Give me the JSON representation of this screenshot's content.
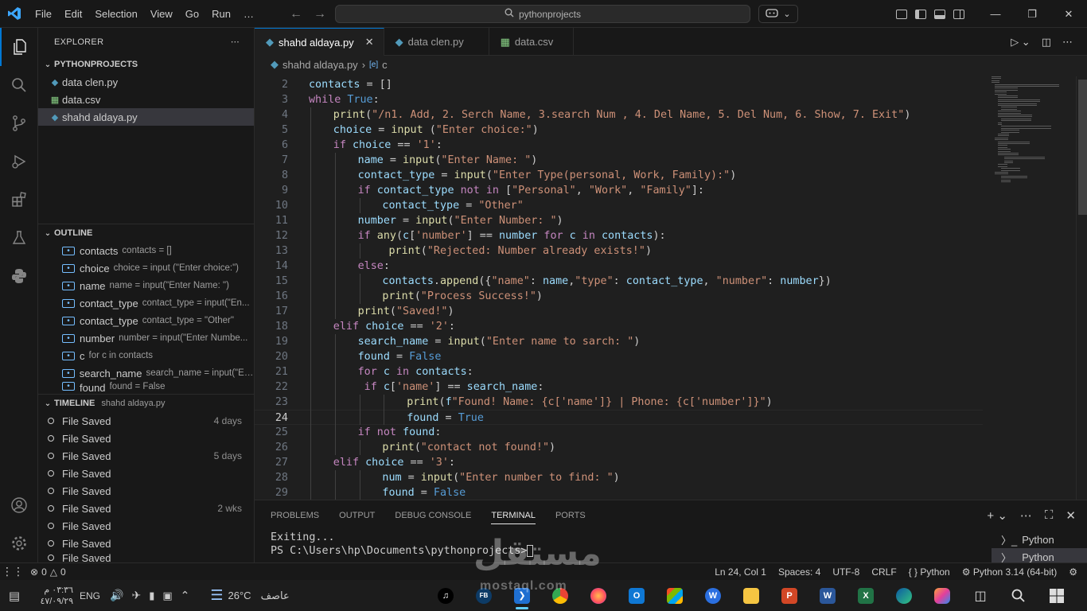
{
  "titlebar": {
    "menu": [
      "File",
      "Edit",
      "Selection",
      "View",
      "Go",
      "Run",
      "…"
    ],
    "search_text": "pythonprojects"
  },
  "explorer": {
    "title": "EXPLORER",
    "folder": "PYTHONPROJECTS",
    "files": [
      {
        "name": "data clen.py",
        "type": "py"
      },
      {
        "name": "data.csv",
        "type": "csv"
      },
      {
        "name": "shahd aldaya.py",
        "type": "py",
        "selected": true
      }
    ]
  },
  "outline": {
    "title": "OUTLINE",
    "items": [
      {
        "name": "contacts",
        "detail": "contacts = []"
      },
      {
        "name": "choice",
        "detail": "choice = input (\"Enter choice:\")"
      },
      {
        "name": "name",
        "detail": "name = input(\"Enter Name: \")"
      },
      {
        "name": "contact_type",
        "detail": "contact_type = input(\"En..."
      },
      {
        "name": "contact_type",
        "detail": "contact_type = \"Other\""
      },
      {
        "name": "number",
        "detail": "number = input(\"Enter Numbe..."
      },
      {
        "name": "c",
        "detail": "for c in contacts"
      },
      {
        "name": "search_name",
        "detail": "search_name = input(\"En..."
      },
      {
        "name": "found",
        "detail": "found = False"
      }
    ]
  },
  "timeline": {
    "title": "TIMELINE",
    "file": "shahd aldaya.py",
    "items": [
      {
        "label": "File Saved",
        "time": "4 days"
      },
      {
        "label": "File Saved",
        "time": ""
      },
      {
        "label": "File Saved",
        "time": "5 days"
      },
      {
        "label": "File Saved",
        "time": ""
      },
      {
        "label": "File Saved",
        "time": ""
      },
      {
        "label": "File Saved",
        "time": "2 wks"
      },
      {
        "label": "File Saved",
        "time": ""
      },
      {
        "label": "File Saved",
        "time": ""
      },
      {
        "label": "File Saved",
        "time": ""
      }
    ]
  },
  "tabs": [
    {
      "name": "shahd aldaya.py",
      "type": "py",
      "active": true
    },
    {
      "name": "data clen.py",
      "type": "py",
      "active": false
    },
    {
      "name": "data.csv",
      "type": "csv",
      "active": false
    }
  ],
  "breadcrumb": {
    "file": "shahd aldaya.py",
    "symbol": "c"
  },
  "code": {
    "current_line": 24,
    "lines": [
      {
        "n": 2,
        "indent": 0,
        "src": "contacts = []"
      },
      {
        "n": 3,
        "indent": 0,
        "src": "while True:"
      },
      {
        "n": 4,
        "indent": 1,
        "src": "print(\"/n1. Add, 2. Serch Name, 3.search Num , 4. Del Name, 5. Del Num, 6. Show, 7. Exit\")"
      },
      {
        "n": 5,
        "indent": 1,
        "src": "choice = input (\"Enter choice:\")"
      },
      {
        "n": 6,
        "indent": 1,
        "src": "if choice == '1':"
      },
      {
        "n": 7,
        "indent": 2,
        "src": "name = input(\"Enter Name: \")"
      },
      {
        "n": 8,
        "indent": 2,
        "src": "contact_type = input(\"Enter Type(personal, Work, Family):\")"
      },
      {
        "n": 9,
        "indent": 2,
        "src": "if contact_type not in [\"Personal\", \"Work\", \"Family\"]:"
      },
      {
        "n": 10,
        "indent": 3,
        "src": "contact_type = \"Other\""
      },
      {
        "n": 11,
        "indent": 2,
        "src": "number = input(\"Enter Number: \")"
      },
      {
        "n": 12,
        "indent": 2,
        "src": "if any(c['number'] == number for c in contacts):"
      },
      {
        "n": 13,
        "indent": 3,
        "src": " print(\"Rejected: Number already exists!\")"
      },
      {
        "n": 14,
        "indent": 2,
        "src": "else:"
      },
      {
        "n": 15,
        "indent": 3,
        "src": "contacts.append({\"name\": name,\"type\": contact_type, \"number\": number})"
      },
      {
        "n": 16,
        "indent": 3,
        "src": "print(\"Process Success!\")"
      },
      {
        "n": 17,
        "indent": 2,
        "src": "print(\"Saved!\")"
      },
      {
        "n": 18,
        "indent": 1,
        "src": "elif choice == '2':"
      },
      {
        "n": 19,
        "indent": 2,
        "src": "search_name = input(\"Enter name to sarch: \")"
      },
      {
        "n": 20,
        "indent": 2,
        "src": "found = False"
      },
      {
        "n": 21,
        "indent": 2,
        "src": "for c in contacts:"
      },
      {
        "n": 22,
        "indent": 2,
        "src": " if c['name'] == search_name:"
      },
      {
        "n": 23,
        "indent": 4,
        "src": "print(f\"Found! Name: {c['name']} | Phone: {c['number']}\")"
      },
      {
        "n": 24,
        "indent": 4,
        "src": "found = True"
      },
      {
        "n": 25,
        "indent": 2,
        "src": "if not found:"
      },
      {
        "n": 26,
        "indent": 3,
        "src": "print(\"contact not found!\")"
      },
      {
        "n": 27,
        "indent": 1,
        "src": "elif choice == '3':"
      },
      {
        "n": 28,
        "indent": 3,
        "src": "num = input(\"Enter number to find: \")"
      },
      {
        "n": 29,
        "indent": 3,
        "src": "found = False"
      }
    ]
  },
  "panel": {
    "tabs": [
      "PROBLEMS",
      "OUTPUT",
      "DEBUG CONSOLE",
      "TERMINAL",
      "PORTS"
    ],
    "active_tab": "TERMINAL",
    "terminal_lines": [
      "Exiting...",
      "PS C:\\Users\\hp\\Documents\\pythonprojects>"
    ],
    "terminals": [
      "Python",
      "Python"
    ]
  },
  "statusbar": {
    "problems": "0",
    "warnings": "0",
    "position": "Ln 24, Col 1",
    "spaces": "Spaces: 4",
    "encoding": "UTF-8",
    "eol": "CRLF",
    "language": "Python",
    "interpreter": "Python 3.14 (64-bit)"
  },
  "taskbar": {
    "time": "٠٣:٣٦ م",
    "date": "٤٧/٠٩/٢٩",
    "lang": "ENG",
    "weather_temp": "26°C",
    "weather_text": "عاصف"
  },
  "watermark": {
    "arabic": "مستقل",
    "latin": "mostaql.com"
  }
}
